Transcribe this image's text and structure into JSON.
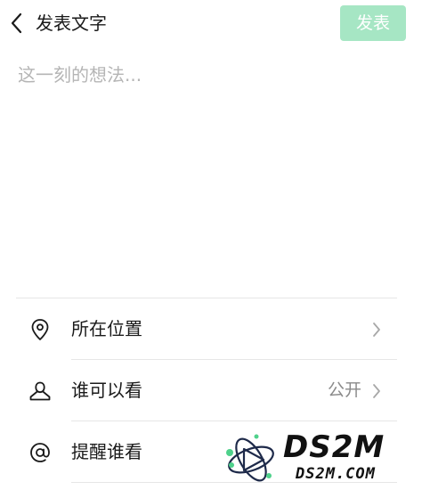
{
  "header": {
    "title": "发表文字",
    "publish_label": "发表"
  },
  "compose": {
    "placeholder": "这一刻的想法..."
  },
  "options": [
    {
      "label": "所在位置",
      "value": ""
    },
    {
      "label": "谁可以看",
      "value": "公开"
    },
    {
      "label": "提醒谁看",
      "value": ""
    }
  ],
  "watermark": {
    "text": "DS2M",
    "sub": "DS2M.COM"
  },
  "colors": {
    "publish_disabled": "#a6e6c4",
    "placeholder": "#b5b5b5",
    "divider": "#e6e6e6"
  }
}
